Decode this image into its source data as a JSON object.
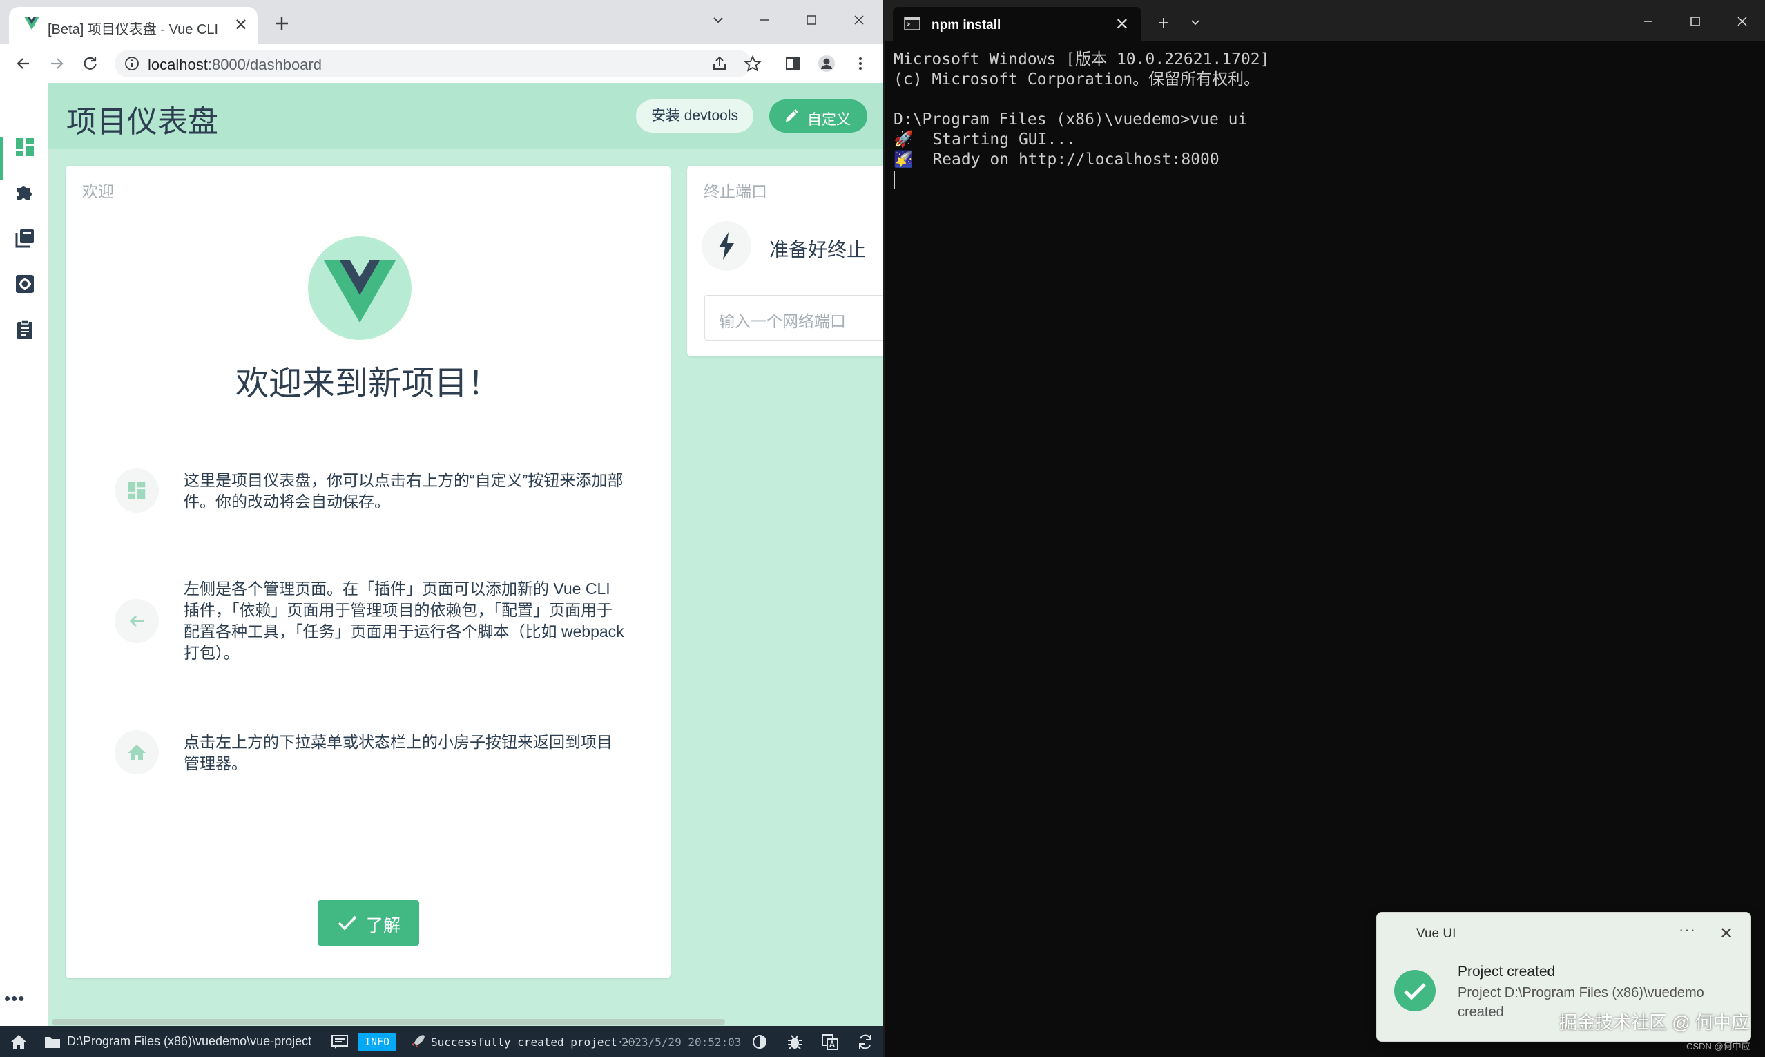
{
  "browser": {
    "tab_title": "[Beta] 项目仪表盘 - Vue CLI",
    "url_host": "localhost",
    "url_rest": ":8000/dashboard"
  },
  "app": {
    "page_title": "项目仪表盘",
    "install_devtools_label": "安装 devtools",
    "customize_label": "自定义",
    "welcome_card": {
      "header": "欢迎",
      "title": "欢迎来到新项目！",
      "tips": [
        "这里是项目仪表盘，你可以点击右上方的“自定义”按钮来添加部件。你的改动将会自动保存。",
        "左侧是各个管理页面。在「插件」页面可以添加新的 Vue CLI 插件，「依赖」页面用于管理项目的依赖包，「配置」页面用于配置各种工具，「任务」页面用于运行各个脚本（比如 webpack 打包）。",
        "点击左上方的下拉菜单或状态栏上的小房子按钮来返回到项目管理器。"
      ],
      "ok_label": "了解"
    },
    "kill_port_card": {
      "header": "终止端口",
      "status": "准备好终止",
      "input_placeholder": "输入一个网络端口"
    },
    "statusbar": {
      "project_path": "D:\\Program Files (x86)\\vuedemo\\vue-project",
      "log_level": "INFO",
      "log_message": "Successfully created project···",
      "log_time": "2023/5/29  20:52:03"
    },
    "accent_color": "#42b983",
    "background_color": "#c4eddb"
  },
  "terminal": {
    "tab_title": "npm install",
    "lines": [
      "Microsoft Windows [版本 10.0.22621.1702]",
      "(c) Microsoft Corporation。保留所有权利。",
      "",
      "D:\\Program Files (x86)\\vuedemo>vue ui",
      "🚀  Starting GUI...",
      "🌠  Ready on http://localhost:8000"
    ]
  },
  "notification": {
    "app_name": "Vue UI",
    "more_label": "···",
    "close_label": "✕",
    "title": "Project created",
    "body": "Project D:\\Program Files (x86)\\vuedemo created"
  },
  "watermark": "掘金技术社区 @ 何中应",
  "csdn_watermark": "CSDN @何中应"
}
